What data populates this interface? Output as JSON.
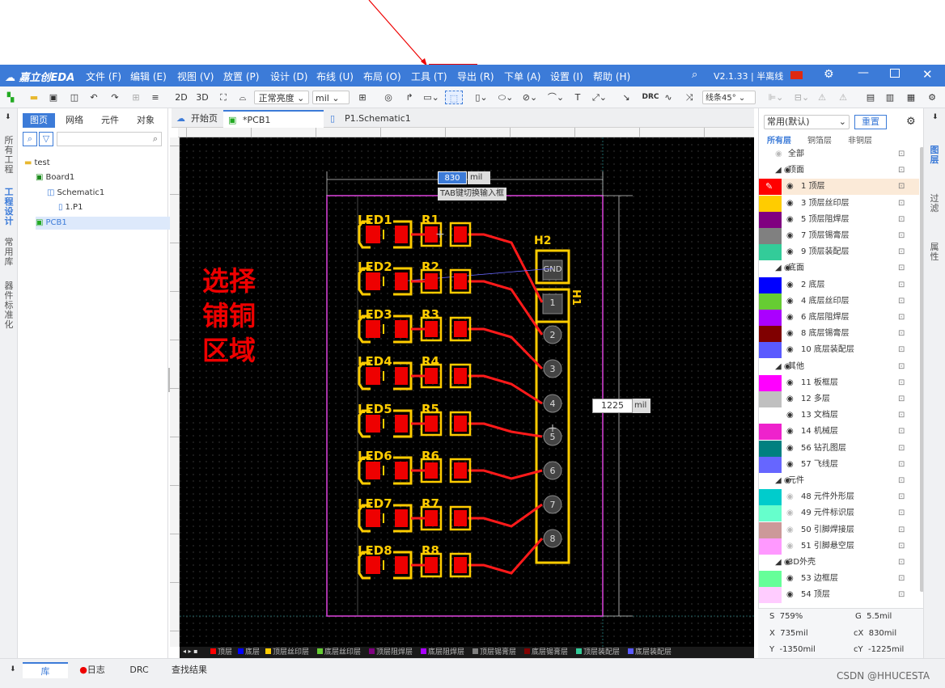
{
  "app": {
    "logo": "嘉立创EDA",
    "version": "V2.1.33 | 半离线"
  },
  "menu": [
    "文件 (F)",
    "编辑 (E)",
    "视图 (V)",
    "放置 (P)",
    "设计 (D)",
    "布线 (U)",
    "布局 (O)",
    "工具 (T)",
    "导出 (R)",
    "下单 (A)",
    "设置 (I)",
    "帮助 (H)"
  ],
  "toolbar": {
    "btn_2d": "2D",
    "btn_3d": "3D",
    "brightness": "正常亮度",
    "unit": "mil",
    "route_angle": "线条45°",
    "drc": "DRC"
  },
  "left_tabs": [
    "所有工程",
    "工程设计",
    "常用库",
    "器件标准化"
  ],
  "left_panel": {
    "tabs": [
      "图页",
      "网络",
      "元件",
      "对象"
    ],
    "tree": [
      {
        "label": "test",
        "level": 0
      },
      {
        "label": "Board1",
        "level": 1
      },
      {
        "label": "Schematic1",
        "level": 2
      },
      {
        "label": "1.P1",
        "level": 3
      },
      {
        "label": "PCB1",
        "level": 1,
        "selected": true
      }
    ]
  },
  "doc_tabs": [
    {
      "label": "开始页"
    },
    {
      "label": "*PCB1",
      "active": true
    },
    {
      "label": "P1.Schematic1"
    }
  ],
  "canvas": {
    "annotation": [
      "选择",
      "铺铜",
      "区域"
    ],
    "width_value": "830",
    "width_unit": "mil",
    "tooltip": "TAB键切换输入框",
    "height_value": "1225",
    "height_unit": "mil",
    "header_label": "H2",
    "header_pins": [
      "GND",
      "1",
      "2",
      "3",
      "4",
      "5",
      "6",
      "7",
      "8"
    ],
    "h1_label": "H1",
    "leds": [
      "LED1",
      "LED2",
      "LED3",
      "LED4",
      "LED5",
      "LED6",
      "LED7",
      "LED8"
    ],
    "resistors": [
      "R1",
      "R2",
      "R3",
      "R4",
      "R5",
      "R6",
      "R7",
      "R8"
    ]
  },
  "layer_bar": [
    "顶层",
    "底层",
    "顶层丝印层",
    "底层丝印层",
    "顶层阻焊层",
    "底层阻焊层",
    "顶层锡膏层",
    "底层锡膏层",
    "顶层装配层",
    "底层装配层"
  ],
  "right_panel": {
    "preset": "常用(默认)",
    "reset": "重置",
    "tabs": [
      "所有层",
      "铜箔层",
      "非铜层"
    ],
    "layers": [
      {
        "label": "全部",
        "color": "",
        "group": true
      },
      {
        "label": "顶面",
        "color": "",
        "group": true
      },
      {
        "label": "1 顶层",
        "color": "#ff0000",
        "active": true
      },
      {
        "label": "3 顶层丝印层",
        "color": "#ffcc00"
      },
      {
        "label": "5 顶层阻焊层",
        "color": "#800080"
      },
      {
        "label": "7 顶层锡膏层",
        "color": "#808080"
      },
      {
        "label": "9 顶层装配层",
        "color": "#33cc99"
      },
      {
        "label": "底面",
        "color": "",
        "group": true
      },
      {
        "label": "2 底层",
        "color": "#0000ff"
      },
      {
        "label": "4 底层丝印层",
        "color": "#66cc33"
      },
      {
        "label": "6 底层阻焊层",
        "color": "#aa00ff"
      },
      {
        "label": "8 底层锡膏层",
        "color": "#800000"
      },
      {
        "label": "10 底层装配层",
        "color": "#5a5aff"
      },
      {
        "label": "其他",
        "color": "",
        "group": true
      },
      {
        "label": "11 板框层",
        "color": "#ff00ff"
      },
      {
        "label": "12 多层",
        "color": "#c0c0c0"
      },
      {
        "label": "13 文档层",
        "color": "#ffffff"
      },
      {
        "label": "14 机械层",
        "color": "#ee22cc"
      },
      {
        "label": "56 钻孔图层",
        "color": "#008080"
      },
      {
        "label": "57 飞线层",
        "color": "#6666ff"
      },
      {
        "label": "元件",
        "color": "",
        "group": true
      },
      {
        "label": "48 元件外形层",
        "color": "#00cccc"
      },
      {
        "label": "49 元件标识层",
        "color": "#66ffcc"
      },
      {
        "label": "50 引脚焊接层",
        "color": "#cc9999"
      },
      {
        "label": "51 引脚悬空层",
        "color": "#ff99ff"
      },
      {
        "label": "3D外壳",
        "color": "",
        "group": true
      },
      {
        "label": "53 边框层",
        "color": "#66ff99"
      },
      {
        "label": "54 顶层",
        "color": "#ffccff"
      }
    ]
  },
  "right_tabs": [
    "图层",
    "过滤",
    "属性"
  ],
  "coords": {
    "s": "S  759%",
    "g": "G  5.5mil",
    "x": "X  735mil",
    "cx": "cX  830mil",
    "y": "Y  -1350mil",
    "cy": "cY  -1225mil"
  },
  "bottom_tabs": [
    "库",
    "日志",
    "DRC",
    "查找结果"
  ],
  "watermark": "CSDN @HHUCESTA"
}
